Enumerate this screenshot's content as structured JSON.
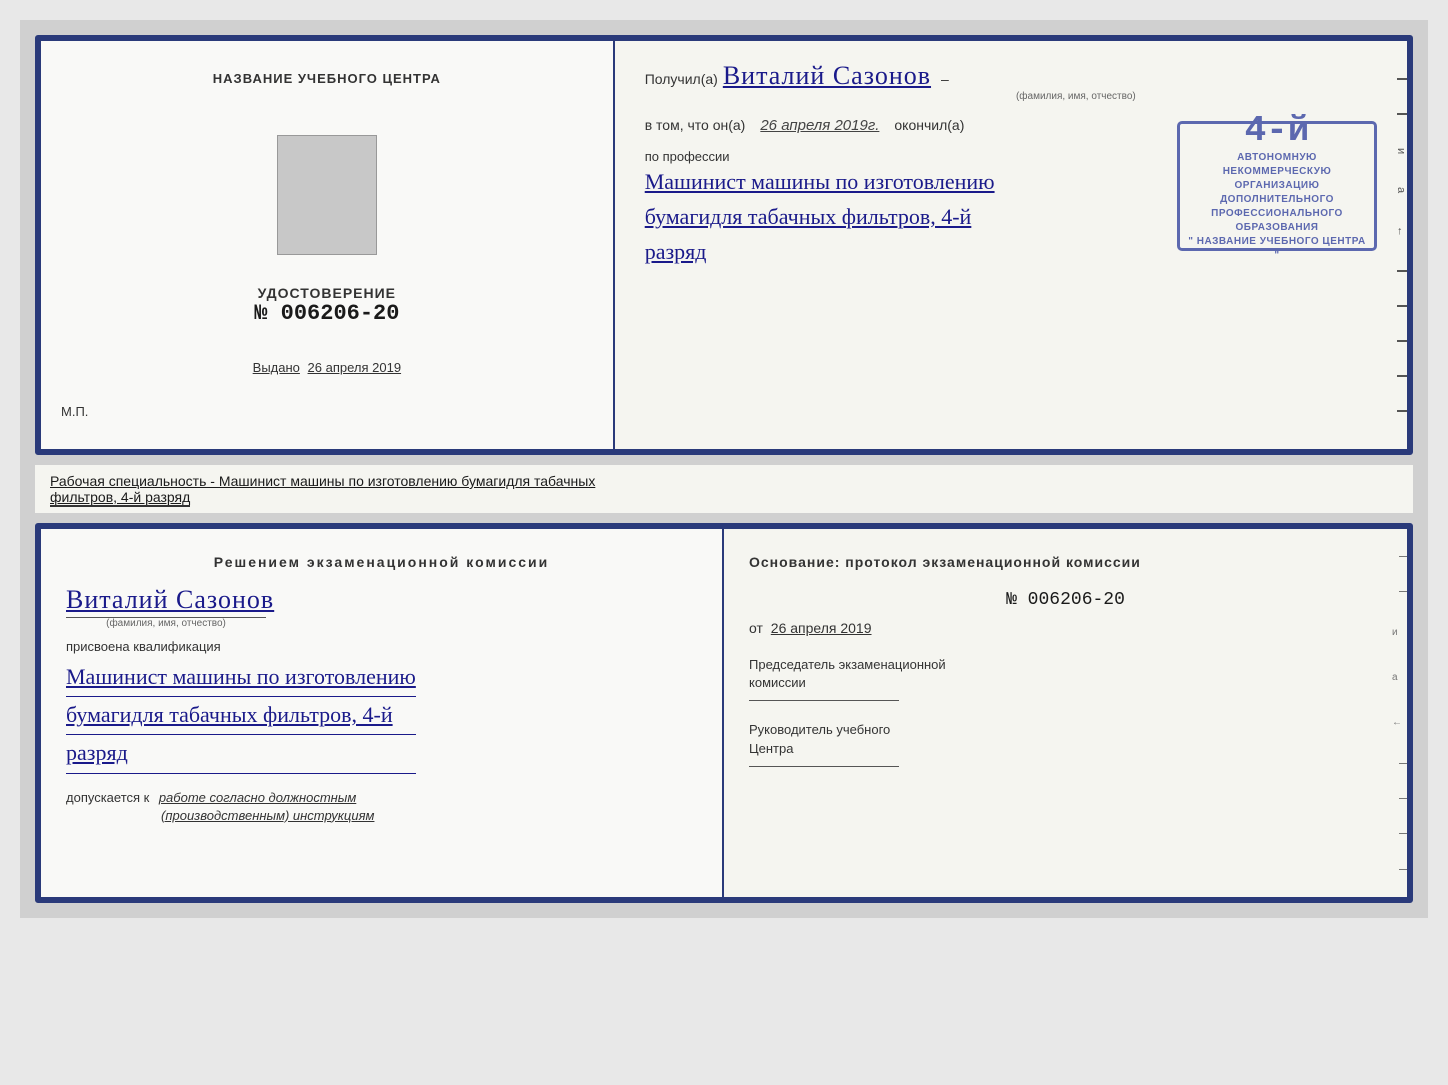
{
  "top_cert": {
    "left": {
      "org_name_label": "НАЗВАНИЕ УЧЕБНОГО ЦЕНТРА",
      "cert_title": "УДОСТОВЕРЕНИЕ",
      "cert_number": "№ 006206-20",
      "issued_label": "Выдано",
      "issued_date": "26 апреля 2019",
      "mp_label": "М.П."
    },
    "right": {
      "received_prefix": "Получил(а)",
      "recipient_name": "Виталий Сазонов",
      "recipient_sublabel": "(фамилия, имя, отчество)",
      "dash": "–",
      "in_fact_text": "в том, что он(а)",
      "date_value": "26 апреля 2019г.",
      "finished_text": "окончил(а)",
      "stamp_number": "4-й",
      "org_line1": "АВТОНОМНУЮ НЕКОММЕРЧЕСКУЮ ОРГАНИЗАЦИЮ",
      "org_line2": "ДОПОЛНИТЕЛЬНОГО ПРОФЕССИОНАЛЬНОГО ОБРАЗОВАНИЯ",
      "org_line3": "\" НАЗВАНИЕ УЧЕБНОГО ЦЕНТРА \"",
      "и_label": "и",
      "а_label": "а",
      "arrow_label": "←",
      "profession_prefix": "по профессии",
      "profession_line1": "Машинист машины по изготовлению",
      "profession_line2": "бумагидля табачных фильтров, 4-й",
      "profession_line3": "разряд"
    }
  },
  "middle": {
    "text_prefix": "Рабочая специальность - Машинист машины по изготовлению бумагидля табачных",
    "text_underlined": "фильтров, 4-й разряд"
  },
  "bottom_cert": {
    "left": {
      "decision_title": "Решением  экзаменационной  комиссии",
      "person_name": "Виталий Сазонов",
      "person_sublabel": "(фамилия, имя, отчество)",
      "assigned_label": "присвоена квалификация",
      "qualification_line1": "Машинист машины по изготовлению",
      "qualification_line2": "бумагидля табачных фильтров, 4-й",
      "qualification_line3": "разряд",
      "allowed_prefix": "допускается к",
      "allowed_text": "работе согласно должностным",
      "allowed_text2": "(производственным) инструкциям"
    },
    "right": {
      "basis_title": "Основание: протокол экзаменационной  комиссии",
      "protocol_number": "№  006206-20",
      "from_label": "от",
      "from_date": "26 апреля 2019",
      "chairman_label": "Председатель экзаменационной\nкомиссии",
      "director_label": "Руководитель учебного\nЦентра",
      "и_label": "и",
      "а_label": "а",
      "arrow_label": "←"
    }
  }
}
